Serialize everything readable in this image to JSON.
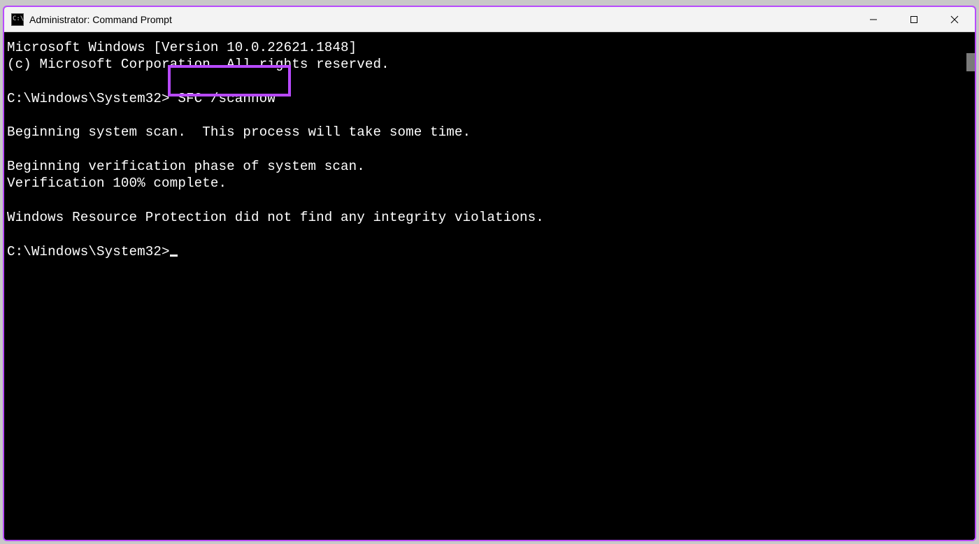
{
  "window": {
    "title": "Administrator: Command Prompt"
  },
  "terminal": {
    "version_line": "Microsoft Windows [Version 10.0.22621.1848]",
    "copyright_line": "(c) Microsoft Corporation. All rights reserved.",
    "prompt1_path": "C:\\Windows\\System32>",
    "command1": " SFC /scannow",
    "out_line1": "Beginning system scan.  This process will take some time.",
    "out_line2": "Beginning verification phase of system scan.",
    "out_line3": "Verification 100% complete.",
    "out_line4": "Windows Resource Protection did not find any integrity violations.",
    "prompt2_path": "C:\\Windows\\System32>"
  },
  "highlight": {
    "color": "#b84aff"
  }
}
